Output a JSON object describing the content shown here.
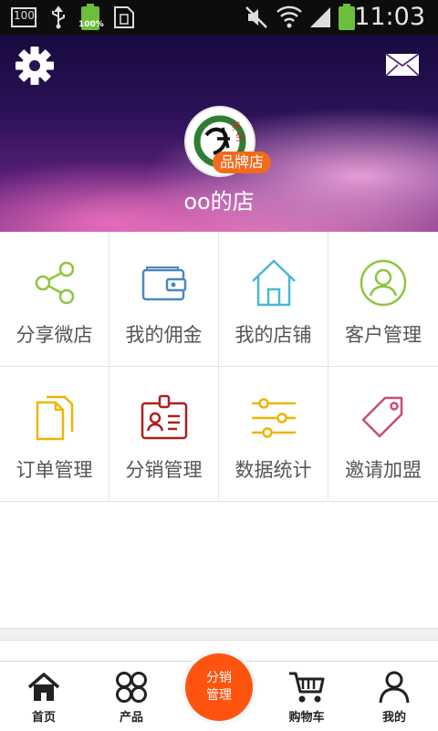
{
  "status_bar": {
    "notification_badge": "100",
    "battery_percent": "100%",
    "time": "11:03",
    "icons": [
      "notification-badge-icon",
      "usb-icon",
      "battery-full-icon",
      "sim-card-icon",
      "muted-icon",
      "wifi-icon",
      "signal-icon",
      "battery-icon"
    ]
  },
  "header": {
    "settings_icon": "gear-icon",
    "message_icon": "envelope-icon",
    "logo_badge": "品牌店",
    "shop_name": "oo的店"
  },
  "grid": [
    {
      "label": "分享微店",
      "icon": "share-icon",
      "color": "#8dc63f"
    },
    {
      "label": "我的佣金",
      "icon": "wallet-icon",
      "color": "#4a86c8"
    },
    {
      "label": "我的店铺",
      "icon": "house-icon",
      "color": "#49b8d6"
    },
    {
      "label": "客户管理",
      "icon": "user-circle-icon",
      "color": "#8dc63f"
    },
    {
      "label": "订单管理",
      "icon": "documents-icon",
      "color": "#f0b400"
    },
    {
      "label": "分销管理",
      "icon": "id-badge-icon",
      "color": "#b01e1e"
    },
    {
      "label": "数据统计",
      "icon": "sliders-icon",
      "color": "#f0b400"
    },
    {
      "label": "邀请加盟",
      "icon": "tag-icon",
      "color": "#c94a7a"
    }
  ],
  "bottom_nav": {
    "home": "首页",
    "products": "产品",
    "center_line1": "分销",
    "center_line2": "管理",
    "cart": "购物车",
    "mine": "我的",
    "center_color": "#ff5410"
  }
}
